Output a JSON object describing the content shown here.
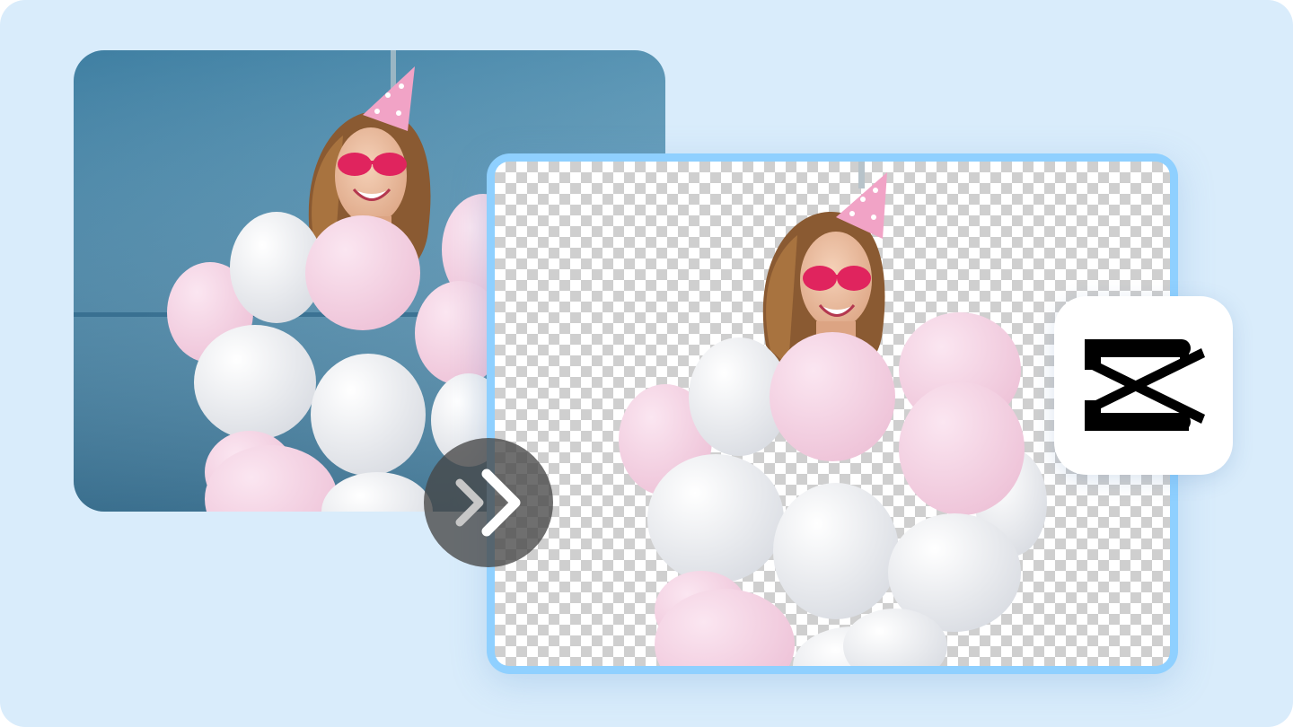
{
  "colors": {
    "page_background": "#d9ecfb",
    "photo_background": "#4e8aa8",
    "card_border": "#8fd0ff",
    "checker_dark": "#cfcfcf",
    "checker_light": "#ffffff",
    "arrow_button_fill": "#464646",
    "arrow_icon": "#ffffff",
    "logo_tile": "#ffffff",
    "logo_mark": "#000000"
  },
  "icons": {
    "arrow": "double-chevron-right-icon",
    "logo": "capcut-logo-icon"
  }
}
